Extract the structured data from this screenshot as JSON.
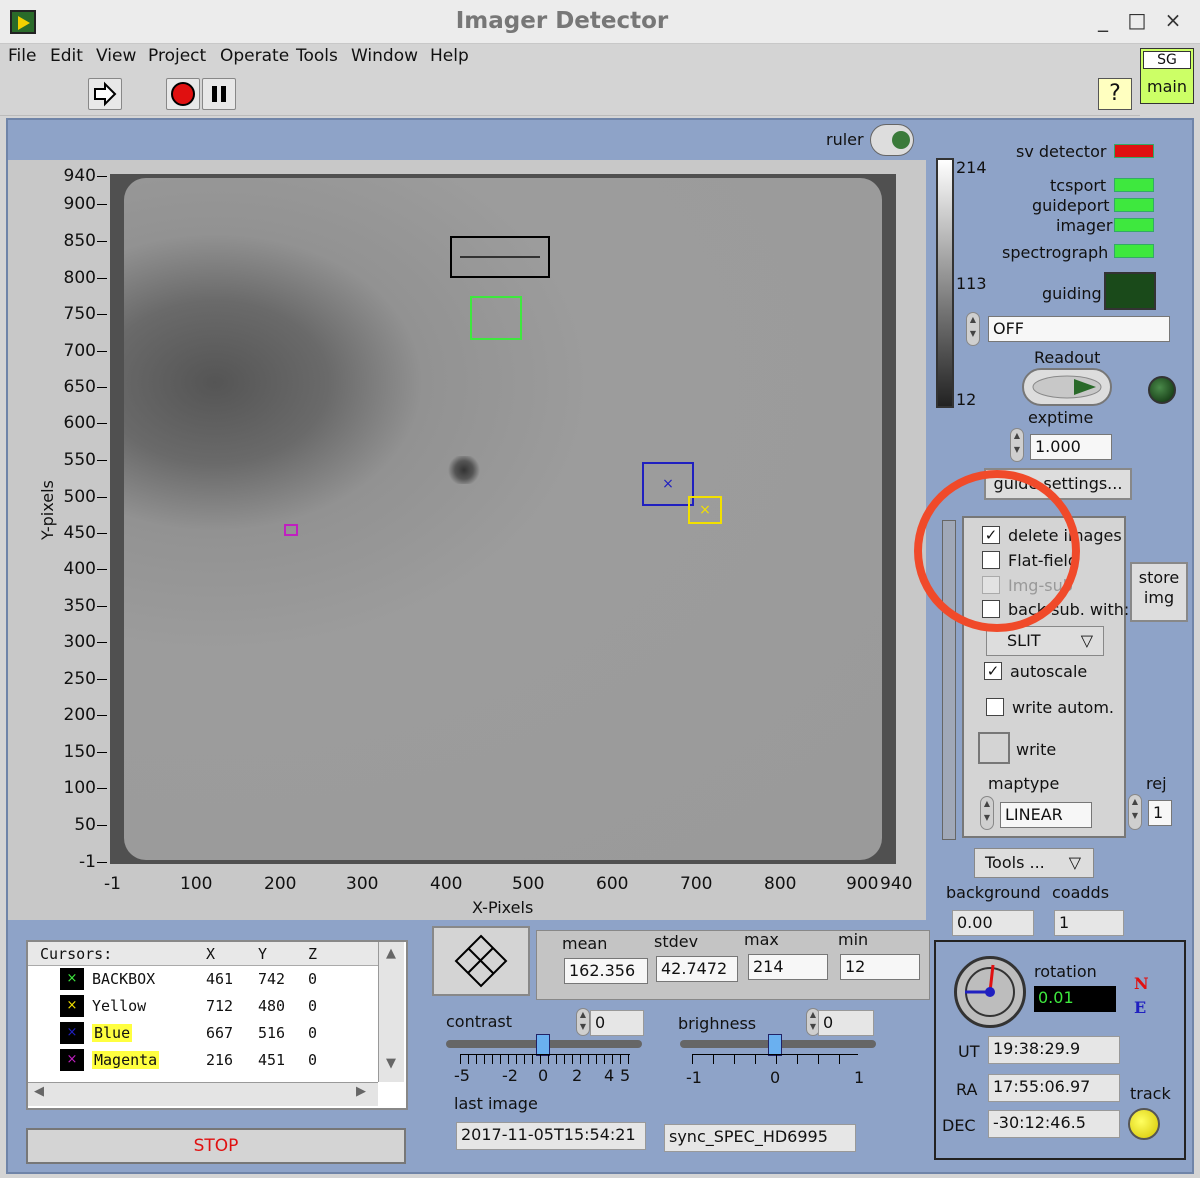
{
  "window": {
    "title": "Imager Detector",
    "controls": [
      "_",
      "□",
      "×"
    ]
  },
  "menu": [
    "File",
    "Edit",
    "View",
    "Project",
    "Operate",
    "Tools",
    "Window",
    "Help"
  ],
  "toolbar": {
    "help": "?",
    "sg_label": "SG",
    "sg_main": "main"
  },
  "ruler_label": "ruler",
  "graph": {
    "ylabel": "Y-pixels",
    "xlabel": "X-Pixels",
    "yticks": [
      "940",
      "900",
      "850",
      "800",
      "750",
      "700",
      "650",
      "600",
      "550",
      "500",
      "450",
      "400",
      "350",
      "300",
      "250",
      "200",
      "150",
      "100",
      "50",
      "-1"
    ],
    "xticks": [
      "-1",
      "100",
      "200",
      "300",
      "400",
      "500",
      "600",
      "700",
      "800",
      "900",
      "940"
    ]
  },
  "intensity_scale": {
    "top": "214",
    "mid": "113",
    "bottom": "12"
  },
  "status": {
    "sv_detector": "sv detector",
    "tcsport": "tcsport",
    "guideport": "guideport",
    "imager": "imager",
    "spectrograph": "spectrograph",
    "guiding": "guiding",
    "sv_color": "#e01010",
    "ok_color": "#3ee83e"
  },
  "readout": {
    "mode_value": "OFF",
    "label": "Readout",
    "exptime_label": "exptime",
    "exptime_value": "1.000",
    "guide_settings": "guide settings..."
  },
  "options": {
    "delete_images": "delete images",
    "flat_field": "Flat-field",
    "img_sub": "Img-sub",
    "back_sub": "back sub. with:",
    "back_sub_value": "SLIT",
    "autoscale": "autoscale",
    "write_autom": "write autom.",
    "write": "write",
    "maptype_label": "maptype",
    "maptype_value": "LINEAR",
    "rej_label": "rej",
    "rej_value": "1",
    "store_img": "store img"
  },
  "tools": {
    "label": "Tools ...",
    "background_label": "background",
    "background_value": "0.00",
    "coadds_label": "coadds",
    "coadds_value": "1"
  },
  "cursors": {
    "header": [
      "Cursors:",
      "X",
      "Y",
      "Z"
    ],
    "rows": [
      {
        "name": "BACKBOX",
        "x": "461",
        "y": "742",
        "z": "0",
        "color": "#3ee83e",
        "highlight": false
      },
      {
        "name": "Yellow",
        "x": "712",
        "y": "480",
        "z": "0",
        "color": "#f2e000",
        "highlight": false
      },
      {
        "name": "Blue",
        "x": "667",
        "y": "516",
        "z": "0",
        "color": "#2020c0",
        "highlight": true
      },
      {
        "name": "Magenta",
        "x": "216",
        "y": "451",
        "z": "0",
        "color": "#c020c0",
        "highlight": true
      }
    ]
  },
  "stop_label": "STOP",
  "stats": {
    "mean_label": "mean",
    "mean": "162.356",
    "stdev_label": "stdev",
    "stdev": "42.7472",
    "max_label": "max",
    "max": "214",
    "min_label": "min",
    "min": "12"
  },
  "contrast": {
    "label": "contrast",
    "value": "0",
    "ticks": [
      "-5",
      "-2",
      "0",
      "2",
      "4",
      "5"
    ]
  },
  "brightness": {
    "label": "brighness",
    "value": "0",
    "ticks": [
      "-1",
      "0",
      "1"
    ]
  },
  "last_image": {
    "label": "last image",
    "value": "2017-11-05T15:54:21",
    "name": "sync_SPEC_HD6995"
  },
  "telescope": {
    "rotation_label": "rotation",
    "rotation": "0.01",
    "ut_label": "UT",
    "ut": "19:38:29.9",
    "ra_label": "RA",
    "ra": "17:55:06.97",
    "dec_label": "DEC",
    "dec": "-30:12:46.5",
    "track_label": "track",
    "north": "N",
    "east": "E"
  }
}
